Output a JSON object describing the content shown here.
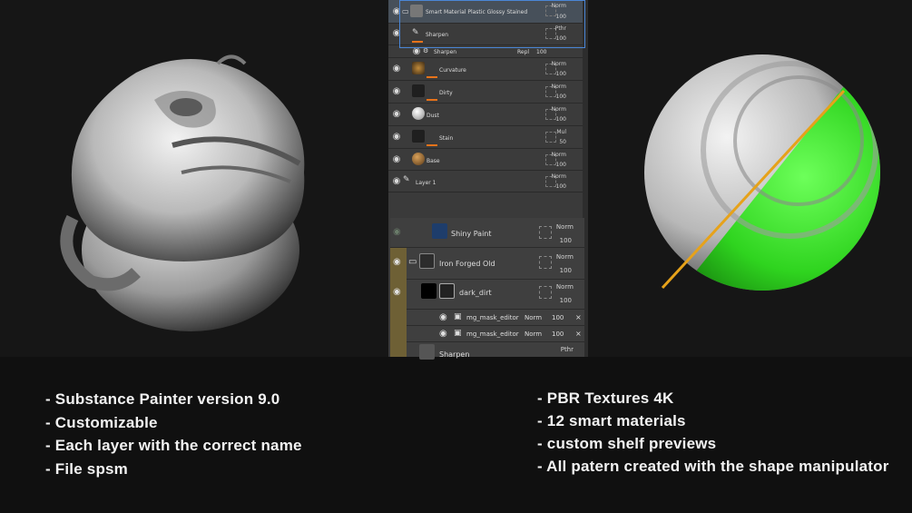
{
  "layers_top": [
    {
      "name": "Smart Material Plastic Glossy Stained",
      "blend": "Norm",
      "opacity": "100"
    },
    {
      "name": "Sharpen",
      "blend": "Pthr",
      "opacity": "100"
    },
    {
      "name": "Sharpen",
      "blend": "Repl",
      "opacity": "100"
    },
    {
      "name": "Curvature",
      "blend": "Norm",
      "opacity": "100"
    },
    {
      "name": "Dirty",
      "blend": "Norm",
      "opacity": "100"
    },
    {
      "name": "Dust",
      "blend": "Norm",
      "opacity": "100"
    },
    {
      "name": "Stain",
      "blend": "Mul",
      "opacity": "50"
    },
    {
      "name": "Base",
      "blend": "Norm",
      "opacity": "100"
    },
    {
      "name": "Layer 1",
      "blend": "Norm",
      "opacity": "100"
    }
  ],
  "layers_bottom": [
    {
      "name": "Shiny Paint",
      "blend": "Norm",
      "opacity": "100"
    },
    {
      "name": "Iron Forged Old",
      "blend": "Norm",
      "opacity": "100"
    },
    {
      "name": "dark_dirt",
      "blend": "Norm",
      "opacity": "100"
    },
    {
      "name": "mg_mask_editor",
      "blend": "Norm",
      "opacity": "100"
    },
    {
      "name": "mg_mask_editor",
      "blend": "Norm",
      "opacity": "100"
    },
    {
      "name": "Sharpen",
      "blend": "Pthr",
      "opacity": ""
    }
  ],
  "features_left": [
    "- Substance Painter version 9.0",
    "- Customizable",
    "- Each layer with the correct name",
    "- File spsm"
  ],
  "features_right": [
    "- PBR Textures 4K",
    "- 12 smart materials",
    "- custom shelf previews",
    "- All patern created with the shape manipulator"
  ]
}
